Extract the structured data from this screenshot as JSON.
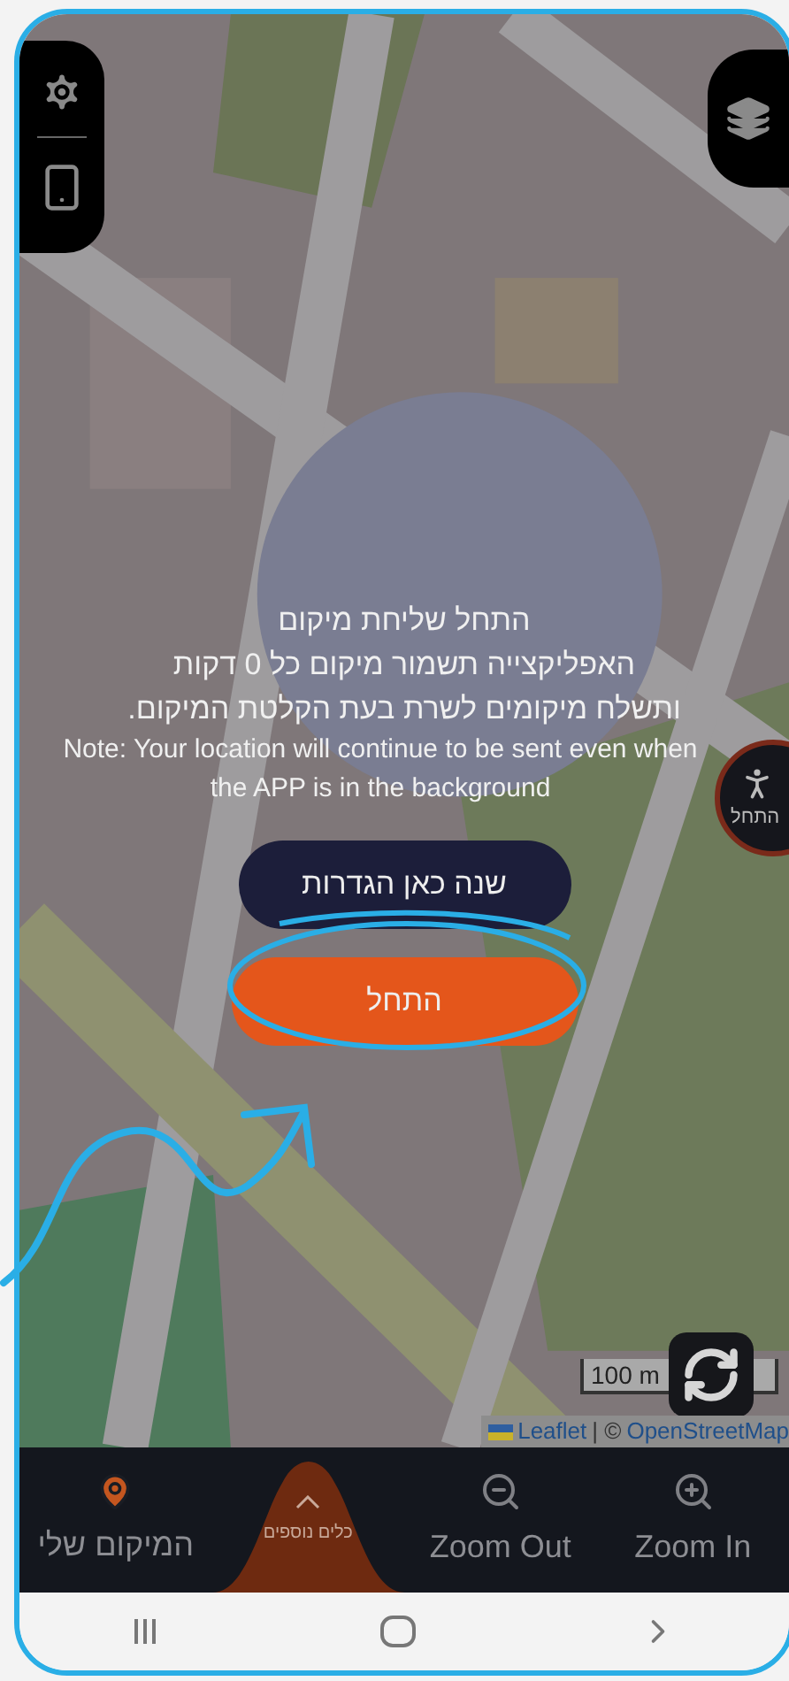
{
  "dialog": {
    "title": "התחל שליחת מיקום",
    "lines": [
      "האפליקצייה תשמור מיקום כל 0 דקות",
      "ותשלח מיקומים לשרת בעת הקלטת המיקום."
    ],
    "note": "Note: Your location will continue to be sent even when the APP is in the background",
    "settings_button": "שנה כאן הגדרות",
    "start_button": "התחל"
  },
  "walk_button": {
    "label": "התחל"
  },
  "map": {
    "scale": "100 m",
    "attribution": {
      "leaflet": "Leaflet",
      "separator": "| ©",
      "osm": "OpenStreetMap"
    }
  },
  "bottom_bar": [
    {
      "kind": "zoom_in",
      "label": "Zoom In"
    },
    {
      "kind": "zoom_out",
      "label": "Zoom Out"
    },
    {
      "kind": "more",
      "label": "כלים נוספים"
    },
    {
      "kind": "location",
      "label": "המיקום שלי"
    }
  ]
}
